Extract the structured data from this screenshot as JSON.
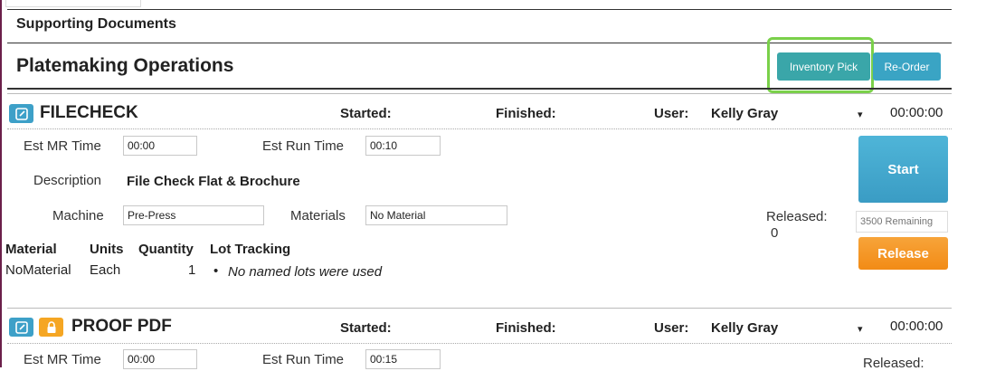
{
  "supporting_documents": {
    "label": "Supporting Documents"
  },
  "platemaking": {
    "title": "Platemaking Operations",
    "inventory_pick_label": "Inventory Pick",
    "reorder_label": "Re-Order"
  },
  "operations": [
    {
      "name": "FILECHECK",
      "started_label": "Started:",
      "finished_label": "Finished:",
      "user_label": "User:",
      "user_value": "Kelly Gray",
      "timer": "00:00:00",
      "est_mr_label": "Est MR Time",
      "est_mr_value": "00:00",
      "est_run_label": "Est Run Time",
      "est_run_value": "00:10",
      "description_label": "Description",
      "description_value": "File Check Flat & Brochure",
      "machine_label": "Machine",
      "machine_value": "Pre-Press",
      "materials_label": "Materials",
      "materials_value": "No Material",
      "released_label": "Released:",
      "released_value": "0",
      "remaining_placeholder": "3500 Remaining",
      "start_label": "Start",
      "release_label": "Release",
      "material_table": {
        "headers": [
          "Material",
          "Units",
          "Quantity",
          "Lot Tracking"
        ],
        "row": {
          "material": "NoMaterial",
          "units": "Each",
          "quantity": "1",
          "lot": "No named lots were used"
        }
      }
    },
    {
      "name": "PROOF PDF",
      "started_label": "Started:",
      "finished_label": "Finished:",
      "user_label": "User:",
      "user_value": "Kelly Gray",
      "timer": "00:00:00",
      "est_mr_label": "Est MR Time",
      "est_mr_value": "00:00",
      "est_run_label": "Est Run Time",
      "est_run_value": "00:15",
      "released_label": "Released:"
    }
  ],
  "icons": {
    "edit": "edit-icon",
    "lock": "lock-icon",
    "caret": "caret-down-icon"
  },
  "colors": {
    "highlight": "#7ad04a",
    "teal_button": "#3aa6a9",
    "start_blue": "#3a9cc4",
    "release_orange": "#f28b16"
  }
}
